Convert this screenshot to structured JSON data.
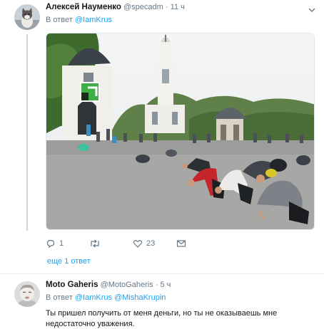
{
  "tweet1": {
    "author_name": "Алексей Науменко",
    "author_handle": "@specadm",
    "separator": "·",
    "time": "11 ч",
    "reply_prefix": "В ответ",
    "reply_mentions": [
      "@IamKrus"
    ],
    "icons": {
      "menu": "chevron-down-icon",
      "avatar": "cat-avatar",
      "reply": "reply-icon",
      "retweet": "retweet-icon",
      "like": "heart-icon",
      "dm": "envelope-icon"
    },
    "actions": {
      "reply_count": "1",
      "retweet_count": "",
      "like_count": "23"
    },
    "more_replies": "еще 1 ответ"
  },
  "tweet2": {
    "author_name": "Moto Gaheris",
    "author_handle": "@MotoGaheris",
    "separator": "·",
    "time": "5 ч",
    "reply_prefix": "В ответ",
    "reply_mentions": [
      "@IamKrus",
      "@MishaKrupin"
    ],
    "text": "Ты пришел получить от меня деньги, но ты не оказываешь мне недостаточно уважения."
  },
  "colors": {
    "link": "#1da1f2",
    "secondary": "#657786",
    "primary_text": "#14171a",
    "divider": "#e6ecf0",
    "thread_line": "#ccd6dd"
  }
}
